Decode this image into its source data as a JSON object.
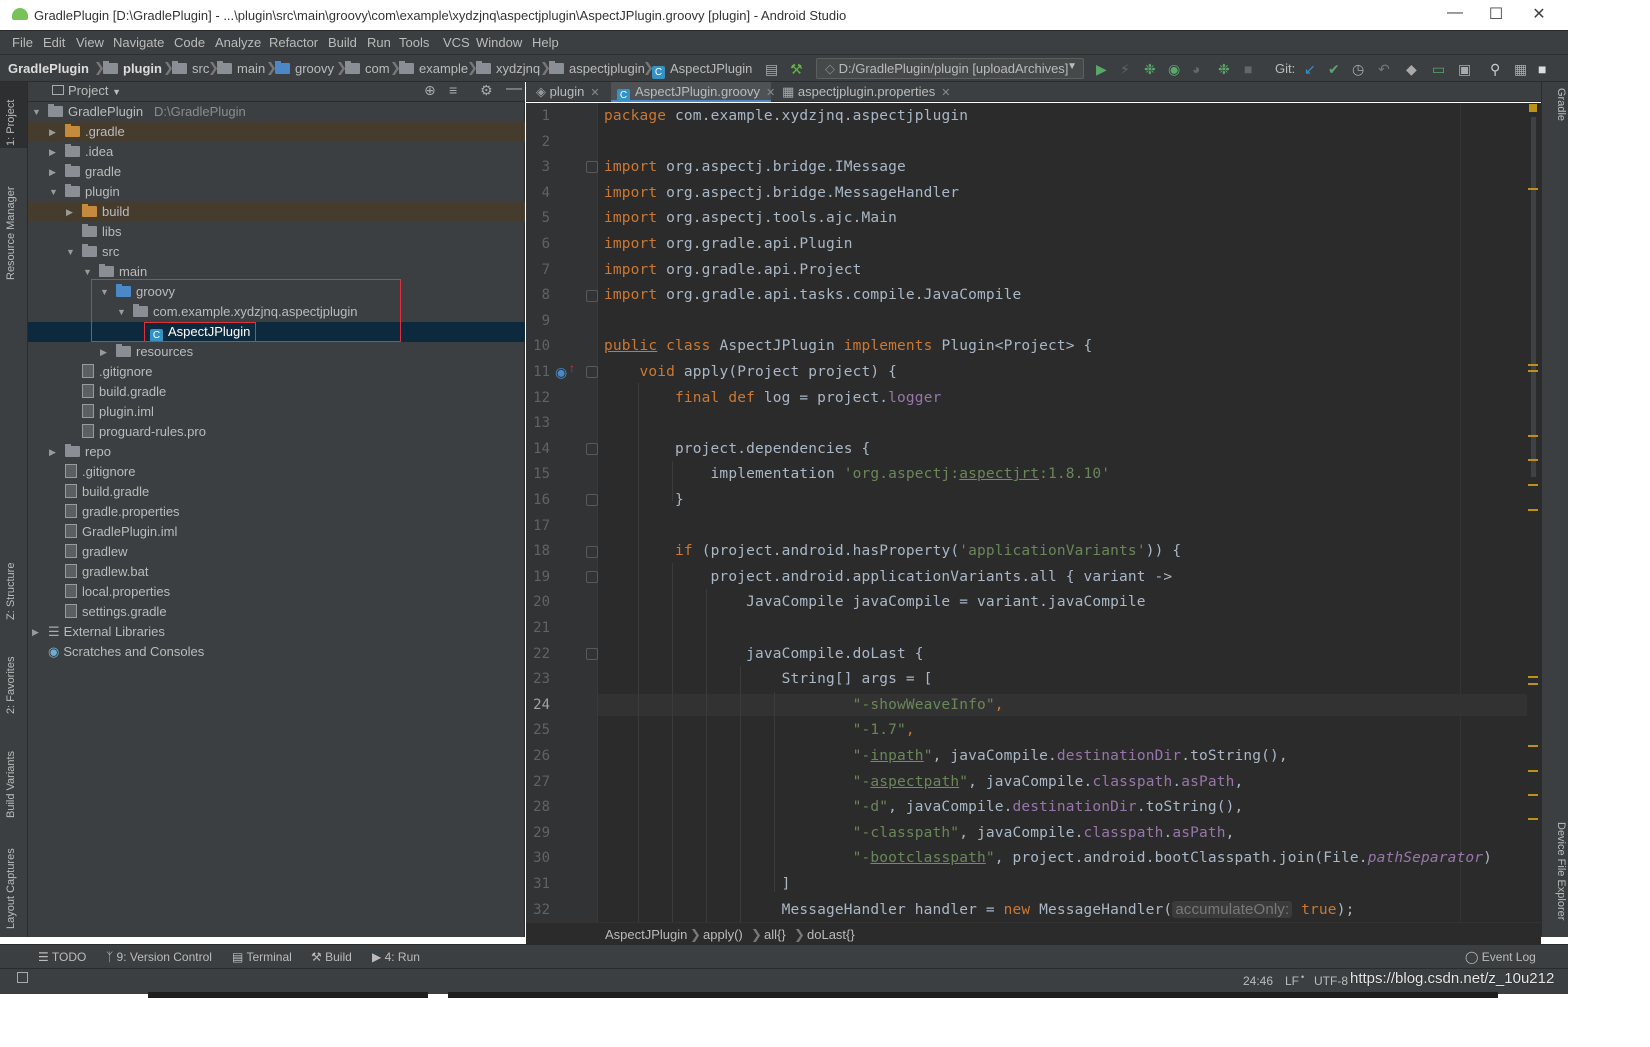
{
  "window": {
    "title": "GradlePlugin [D:\\GradlePlugin] - ...\\plugin\\src\\main\\groovy\\com\\example\\xydzjnq\\aspectjplugin\\AspectJPlugin.groovy [plugin] - Android Studio"
  },
  "menu": [
    "File",
    "Edit",
    "View",
    "Navigate",
    "Code",
    "Analyze",
    "Refactor",
    "Build",
    "Run",
    "Tools",
    "VCS",
    "Window",
    "Help"
  ],
  "breadcrumbs": [
    "GradlePlugin",
    "plugin",
    "src",
    "main",
    "groovy",
    "com",
    "example",
    "xydzjnq",
    "aspectjplugin",
    "AspectJPlugin"
  ],
  "run_config": "D:/GradlePlugin/plugin [uploadArchives]",
  "git_label": "Git:",
  "left_tabs": [
    "1: Project",
    "Resource Manager",
    "Z: Structure",
    "2: Favorites",
    "Build Variants",
    "Layout Captures"
  ],
  "right_tabs": [
    "Gradle",
    "Device File Explorer"
  ],
  "project_panel": {
    "title": "Project"
  },
  "tree": [
    {
      "label": "GradlePlugin",
      "extra": "D:\\GradlePlugin"
    },
    {
      "label": ".gradle"
    },
    {
      "label": ".idea"
    },
    {
      "label": "gradle"
    },
    {
      "label": "plugin"
    },
    {
      "label": "build"
    },
    {
      "label": "libs"
    },
    {
      "label": "src"
    },
    {
      "label": "main"
    },
    {
      "label": "groovy"
    },
    {
      "label": "com.example.xydzjnq.aspectjplugin"
    },
    {
      "label": "AspectJPlugin"
    },
    {
      "label": "resources"
    },
    {
      "label": ".gitignore"
    },
    {
      "label": "build.gradle"
    },
    {
      "label": "plugin.iml"
    },
    {
      "label": "proguard-rules.pro"
    },
    {
      "label": "repo"
    },
    {
      "label": ".gitignore"
    },
    {
      "label": "build.gradle"
    },
    {
      "label": "gradle.properties"
    },
    {
      "label": "GradlePlugin.iml"
    },
    {
      "label": "gradlew"
    },
    {
      "label": "gradlew.bat"
    },
    {
      "label": "local.properties"
    },
    {
      "label": "settings.gradle"
    },
    {
      "label": "External Libraries"
    },
    {
      "label": "Scratches and Consoles"
    }
  ],
  "editor_tabs": [
    "plugin",
    "AspectJPlugin.groovy",
    "aspectjplugin.properties"
  ],
  "line_numbers": [
    "1",
    "2",
    "3",
    "4",
    "5",
    "6",
    "7",
    "8",
    "9",
    "10",
    "11",
    "12",
    "13",
    "14",
    "15",
    "16",
    "17",
    "18",
    "19",
    "20",
    "21",
    "22",
    "23",
    "24",
    "25",
    "26",
    "27",
    "28",
    "29",
    "30",
    "31",
    "32"
  ],
  "code": {
    "l1a": "package",
    "l1b": " com.example.xydzjnq.aspectjplugin",
    "imp": "import",
    "l3": " org.aspectj.bridge.IMessage",
    "l4": " org.aspectj.bridge.MessageHandler",
    "l5": " org.aspectj.tools.ajc.Main",
    "l6": " org.gradle.api.Plugin",
    "l7": " org.gradle.api.Project",
    "l8": " org.gradle.api.tasks.compile.JavaCompile",
    "l10a": "public",
    "l10b": " class",
    "l10c": " AspectJPlugin ",
    "l10d": "implements",
    "l10e": " Plugin<Project> {",
    "l11a": "    void",
    "l11b": " apply(Project project) {",
    "l12a": "        final def",
    "l12b": " log = project.",
    "l12c": "logger",
    "l14": "        project.dependencies {",
    "l15a": "            implementation ",
    "l15b": "'org.aspectj:",
    "l15c": "aspectjrt",
    "l15d": ":1.8.10'",
    "l16": "        }",
    "l18a": "        if",
    "l18b": " (project.android.hasProperty(",
    "l18c": "'applicationVariants'",
    "l18d": ")) {",
    "l19": "            project.android.applicationVariants.all { variant ->",
    "l20": "                JavaCompile javaCompile = variant.javaCompile",
    "l22": "                javaCompile.doLast {",
    "l23": "                    String[] args = [",
    "l24a": "                            \"-showWeaveInfo\"",
    "l24b": ",",
    "l25a": "                            \"-1.7\"",
    "l25b": ",",
    "l26a": "                            \"-",
    "l26b": "inpath",
    "l26c": "\"",
    "l26d": ", javaCompile.",
    "l26e": "destinationDir",
    "l26f": ".toString(),",
    "l27a": "                            \"-",
    "l27b": "aspectpath",
    "l27c": "\"",
    "l27d": ", javaCompile.",
    "l27e": "classpath",
    "l27f": ".",
    "l27g": "asPath",
    ",": ",",
    "l28a": "                            \"-d\"",
    "l28b": ", javaCompile.",
    "l28c": "destinationDir",
    "l28d": ".toString(),",
    "l29a": "                            \"-classpath\"",
    "l29b": ", javaCompile.",
    "l29c": "classpath",
    "l29d": ".",
    "l29e": "asPath",
    "l29f": ",",
    "l30a": "                            \"-",
    "l30b": "bootclasspath",
    "l30c": "\"",
    "l30d": ", project.android.bootClasspath.join(File.",
    "l30e": "pathSeparator",
    "l30f": ")",
    "l31": "                    ]",
    "l32a": "                    MessageHandler handler = ",
    "l32b": "new",
    "l32c": " MessageHandler(",
    "l32d": "accumulateOnly:",
    "l32e": " true",
    "l32f": ");"
  },
  "editor_breadcrumb": [
    "AspectJPlugin",
    "apply()",
    "all{}",
    "doLast{}"
  ],
  "tool_windows": [
    "TODO",
    "9: Version Control",
    "Terminal",
    "Build",
    "4: Run"
  ],
  "event_log": "Event Log",
  "status": {
    "position": "24:46",
    "line_sep": "LF",
    "encoding": "UTF-8",
    "watermark": "https://blog.csdn.net/z_10u212"
  },
  "colors": {
    "accent": "#4a88c7",
    "highlight_box": "#e0313a",
    "keyword": "#cc7832",
    "string": "#6a8759",
    "field": "#9876aa"
  }
}
